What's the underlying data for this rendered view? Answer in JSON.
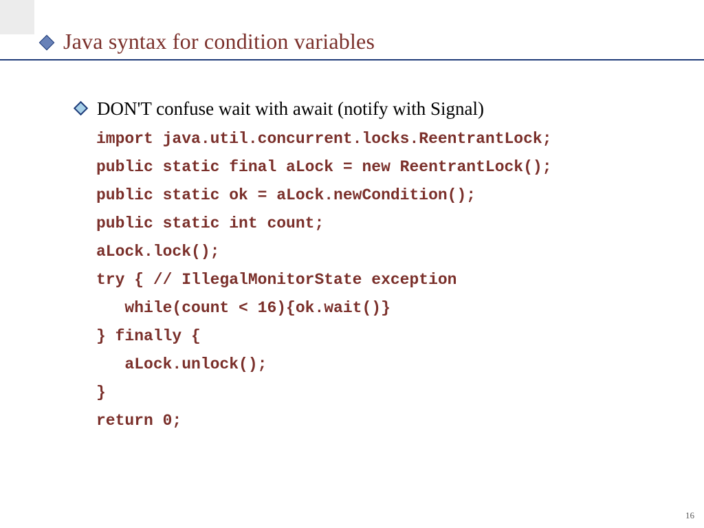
{
  "title": "Java syntax for condition variables",
  "bullet": "DON'T confuse wait with await (notify with Signal)",
  "code": {
    "l1": "import java.util.concurrent.locks.ReentrantLock;",
    "l2": "public static final aLock = new ReentrantLock();",
    "l3": "public static ok = aLock.newCondition();",
    "l4": "public static int count;",
    "l5": "aLock.lock();",
    "l6": "try { // IllegalMonitorState exception",
    "l7": "   while(count < 16){ok.wait()}",
    "l8": "} finally {",
    "l9": "   aLock.unlock();",
    "l10": "}",
    "l11": "return 0;"
  },
  "page_number": "16"
}
